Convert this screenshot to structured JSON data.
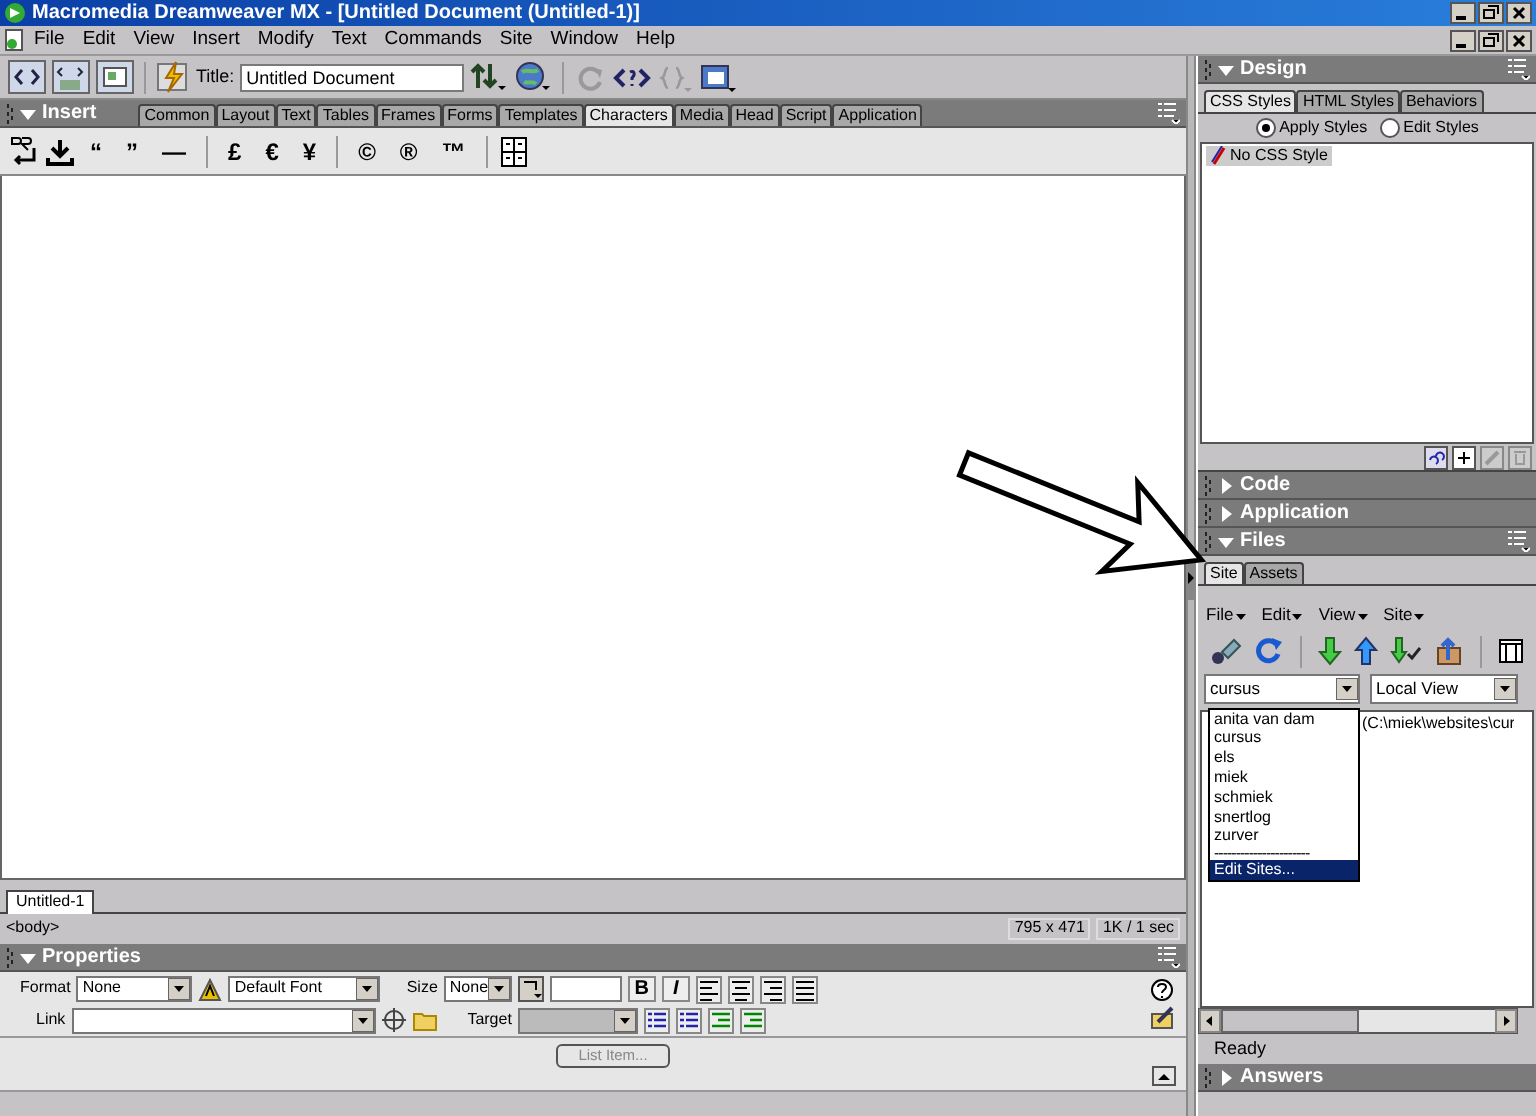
{
  "window": {
    "title": "Macromedia Dreamweaver MX - [Untitled Document (Untitled-1)]"
  },
  "menu": [
    "File",
    "Edit",
    "View",
    "Insert",
    "Modify",
    "Text",
    "Commands",
    "Site",
    "Window",
    "Help"
  ],
  "toolbar": {
    "title_label": "Title:",
    "title_value": "Untitled Document"
  },
  "insert_panel": {
    "title": "Insert",
    "expanded": true,
    "tabs": [
      {
        "label": "Common",
        "selected": false
      },
      {
        "label": "Layout",
        "selected": false
      },
      {
        "label": "Text",
        "selected": false
      },
      {
        "label": "Tables",
        "selected": false
      },
      {
        "label": "Frames",
        "selected": false
      },
      {
        "label": "Forms",
        "selected": false
      },
      {
        "label": "Templates",
        "selected": false
      },
      {
        "label": "Characters",
        "selected": true
      },
      {
        "label": "Media",
        "selected": false
      },
      {
        "label": "Head",
        "selected": false
      },
      {
        "label": "Script",
        "selected": false
      },
      {
        "label": "Application",
        "selected": false
      }
    ],
    "characters": [
      "“",
      "”",
      "—",
      "£",
      "€",
      "¥",
      "©",
      "®",
      "™"
    ]
  },
  "document": {
    "tab": "Untitled-1",
    "tag_selector": "<body>",
    "window_size": "795 x 471",
    "download_time": "1K / 1 sec"
  },
  "properties": {
    "title": "Properties",
    "expanded": true,
    "format_label": "Format",
    "format_value": "None",
    "font_value": "Default Font",
    "size_label": "Size",
    "size_value": "None",
    "bold": "B",
    "italic": "I",
    "link_label": "Link",
    "target_label": "Target",
    "list_item_button": "List Item..."
  },
  "design_panel": {
    "title": "Design",
    "expanded": true,
    "tabs": [
      {
        "label": "CSS Styles",
        "selected": true
      },
      {
        "label": "HTML Styles",
        "selected": false
      },
      {
        "label": "Behaviors",
        "selected": false
      }
    ],
    "radios": [
      {
        "label": "Apply Styles",
        "selected": true
      },
      {
        "label": "Edit Styles",
        "selected": false
      }
    ],
    "styles": [
      {
        "label": "No CSS Style",
        "selected": true
      }
    ]
  },
  "collapsed_panels": [
    {
      "title": "Code",
      "expanded": false
    },
    {
      "title": "Application",
      "expanded": false
    }
  ],
  "files_panel": {
    "title": "Files",
    "expanded": true,
    "tabs": [
      {
        "label": "Site",
        "selected": true
      },
      {
        "label": "Assets",
        "selected": false
      }
    ],
    "menus": [
      "File",
      "Edit",
      "View",
      "Site"
    ],
    "site_value": "cursus",
    "view_value": "Local View",
    "path": "(C:\\miek\\websites\\cur",
    "site_options": [
      {
        "kind": "site",
        "label": "anita van dam",
        "selected": false
      },
      {
        "kind": "site",
        "label": "cursus",
        "selected": false
      },
      {
        "kind": "site",
        "label": "els",
        "selected": false
      },
      {
        "kind": "site",
        "label": "miek",
        "selected": false
      },
      {
        "kind": "site",
        "label": "schmiek",
        "selected": false
      },
      {
        "kind": "site",
        "label": "snertlog",
        "selected": false
      },
      {
        "kind": "site",
        "label": "zurver",
        "selected": false
      },
      {
        "kind": "separator",
        "label": "----------------------",
        "selected": false
      },
      {
        "kind": "command",
        "label": "Edit Sites...",
        "selected": true
      }
    ]
  },
  "status": "Ready",
  "answers_panel": {
    "title": "Answers",
    "expanded": false
  }
}
